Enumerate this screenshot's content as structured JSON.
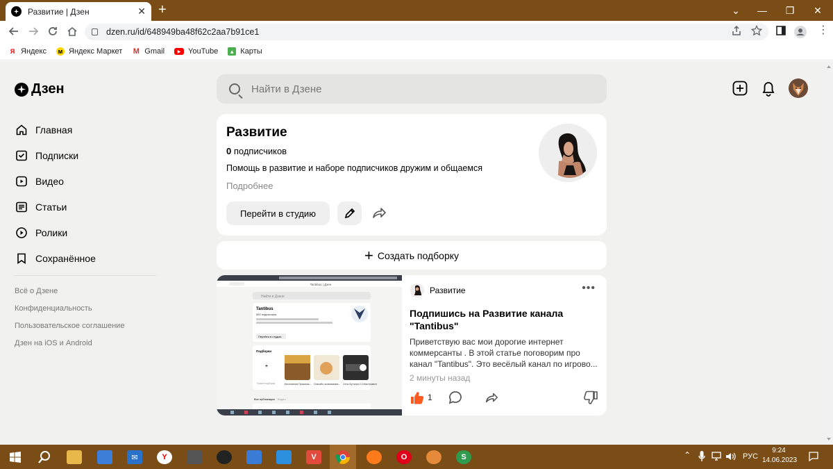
{
  "browser": {
    "tab_title": "Развитие | Дзен",
    "tab_close": "✕",
    "new_tab": "+",
    "url": "dzen.ru/id/648949ba48f62c2aa7b91ce1",
    "window_controls": [
      "⌄",
      "—",
      "❐",
      "✕"
    ],
    "bookmarks": [
      {
        "label": "Яндекс",
        "icon": "yandex-icon"
      },
      {
        "label": "Яндекс Маркет",
        "icon": "market-icon"
      },
      {
        "label": "Gmail",
        "icon": "gmail-icon"
      },
      {
        "label": "YouTube",
        "icon": "youtube-icon"
      },
      {
        "label": "Карты",
        "icon": "maps-icon"
      }
    ]
  },
  "header": {
    "logo": "Дзен",
    "search_placeholder": "Найти в Дзене"
  },
  "sidebar": {
    "items": [
      {
        "label": "Главная",
        "icon": "home-icon"
      },
      {
        "label": "Подписки",
        "icon": "subscriptions-icon"
      },
      {
        "label": "Видео",
        "icon": "video-icon"
      },
      {
        "label": "Статьи",
        "icon": "articles-icon"
      },
      {
        "label": "Ролики",
        "icon": "shorts-icon"
      },
      {
        "label": "Сохранённое",
        "icon": "bookmark-icon"
      }
    ],
    "links": [
      "Всё о Дзене",
      "Конфиденциальность",
      "Пользовательское соглашение",
      "Дзен на iOS и Android"
    ]
  },
  "channel": {
    "title": "Развитие",
    "subscribers_count": "0",
    "subscribers_label": "подписчиков",
    "description": "Помощь в развитие и наборе подписчиков дружим и общаемся",
    "more": "Подробнее",
    "studio_button": "Перейти в студию"
  },
  "create_collection": "Создать подборку",
  "post": {
    "author": "Развитие",
    "menu": "•••",
    "title": "Подпишись на Развитие канала \"Tantibus\"",
    "text": "Приветствую вас мои дорогие интернет коммерсанты . В этой статье поговорим про канал \"Tantibus\". Это весёлый канал по игрово...",
    "time": "2 минуты назад",
    "likes": "1",
    "thumbnail": {
      "tab": "Tantibus | Дзен",
      "search": "Найти в Дзене",
      "channel": "Tantibus",
      "subs": "552 подписчика",
      "studio": "Перейти в студию",
      "collections": "Подборки",
      "new_collection": "Новая подборка",
      "item1": "Бесплатная Прокачка...",
      "item2": "Спасибо за внимание...",
      "item3": "Сеты Бутчера 2.0 Мастервелл",
      "feed": "Все публикации",
      "feed2": "Видео"
    }
  },
  "taskbar": {
    "lang": "РУС",
    "time": "9:24",
    "date": "14.06.2023"
  },
  "colors": {
    "chrome_frame": "#7a4d16",
    "page_bg": "#f1f1f0",
    "card_bg": "#ffffff",
    "like": "#ff5a1f"
  }
}
